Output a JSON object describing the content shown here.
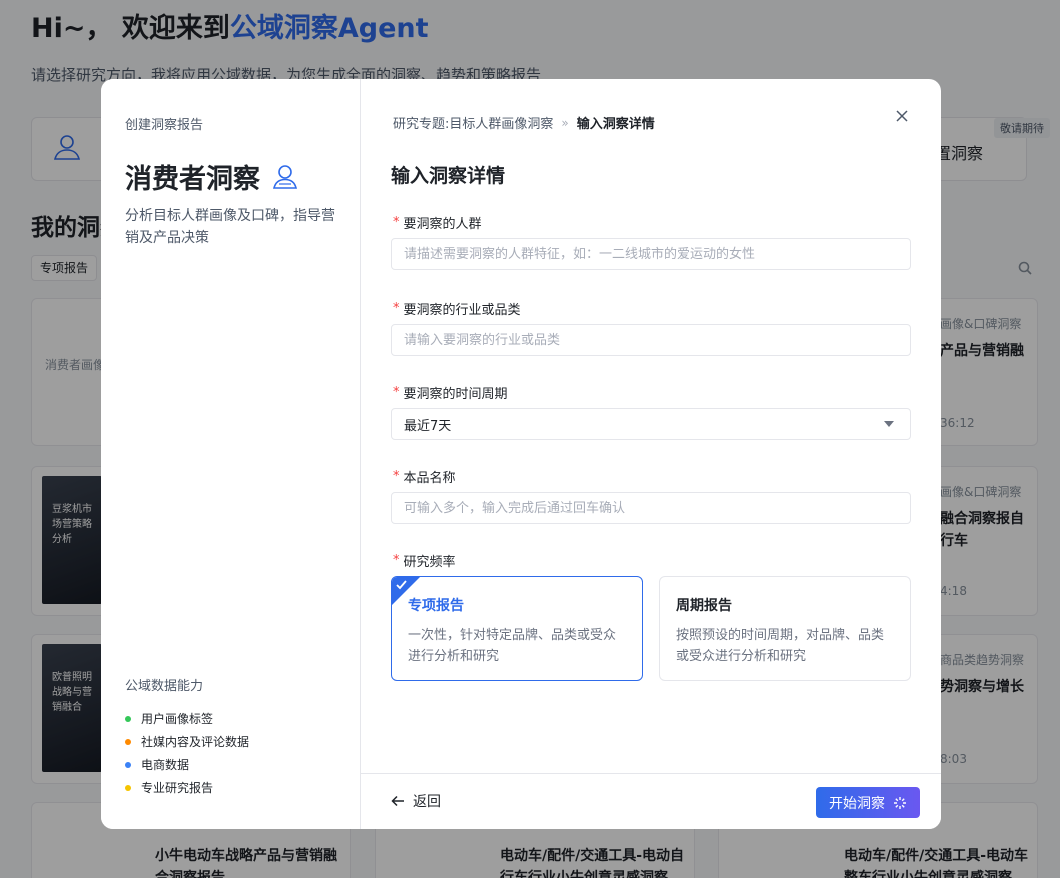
{
  "background": {
    "greeting_prefix": "Hi~， 欢迎来到",
    "greeting_brand": "公域洞察Agent",
    "subtitle": "请选择研究方向，我将应用公域数据，为您生成全面的洞察、趋势和策略报告",
    "coming_soon": "敬请期待",
    "right_card_label": "置洞察",
    "section_title": "我的洞察",
    "tab_label": "专项报告",
    "reports": [
      {
        "cat": "消费者画像",
        "title": "",
        "time": ""
      },
      {
        "cat": "",
        "title": "豆浆机市场营策略分析",
        "time": ""
      },
      {
        "cat": "",
        "title": "欧普照明战略与营销融合",
        "time": ""
      },
      {
        "cat": "",
        "title": "小牛电动车战略产品与营销融合洞察报告",
        "time": ""
      }
    ],
    "right_col": [
      {
        "cat": "画像&口碑洞察",
        "title": "产品与营销融",
        "time": "36:12"
      },
      {
        "cat": "画像&口碑洞察",
        "title": "融合洞察报自行车",
        "time": "4:18"
      },
      {
        "cat": "商品类趋势洞察",
        "title": "势洞察与增长",
        "time": "8:03"
      }
    ],
    "bottom_row": [
      {
        "title": "小牛电动车战略产品与营销融合洞察报告"
      },
      {
        "title": "电动车/配件/交通工具-电动自行车行业小牛创意灵感洞察"
      },
      {
        "title": "电动车/配件/交通工具-电动车整车行业小牛创意灵感洞察"
      }
    ]
  },
  "side": {
    "eyebrow": "创建洞察报告",
    "title": "消费者洞察",
    "description": "分析目标人群画像及口碑，指导营销及产品决策",
    "capabilities_title": "公域数据能力",
    "capabilities": [
      {
        "label": "用户画像标签",
        "color": "#34c759"
      },
      {
        "label": "社媒内容及评论数据",
        "color": "#ff8a00"
      },
      {
        "label": "电商数据",
        "color": "#3b82f6"
      },
      {
        "label": "专业研究报告",
        "color": "#f5c400"
      }
    ]
  },
  "breadcrumb": {
    "parent": "研究专题:目标人群画像洞察",
    "separator": "»",
    "current": "输入洞察详情"
  },
  "form": {
    "title": "输入洞察详情",
    "audience": {
      "label": "要洞察的人群",
      "placeholder": "请描述需要洞察的人群特征，如：一二线城市的爱运动的女性",
      "value": ""
    },
    "industry": {
      "label": "要洞察的行业或品类",
      "placeholder": "请输入要洞察的行业或品类",
      "value": ""
    },
    "period": {
      "label": "要洞察的时间周期",
      "selected": "最近7天"
    },
    "brand": {
      "label": "本品名称",
      "placeholder": "可输入多个，输入完成后通过回车确认",
      "value": ""
    },
    "frequency": {
      "label": "研究频率",
      "options": [
        {
          "title": "专项报告",
          "desc": "一次性，针对特定品牌、品类或受众进行分析和研究",
          "selected": true
        },
        {
          "title": "周期报告",
          "desc": "按照预设的时间周期，对品牌、品类或受众进行分析和研究",
          "selected": false
        }
      ]
    },
    "required_mark": "*"
  },
  "footer": {
    "back_label": "返回",
    "start_label": "开始洞察"
  },
  "colors": {
    "accent": "#2f6bea",
    "required": "#f53f3f",
    "gradient_end": "#6a58f0"
  }
}
